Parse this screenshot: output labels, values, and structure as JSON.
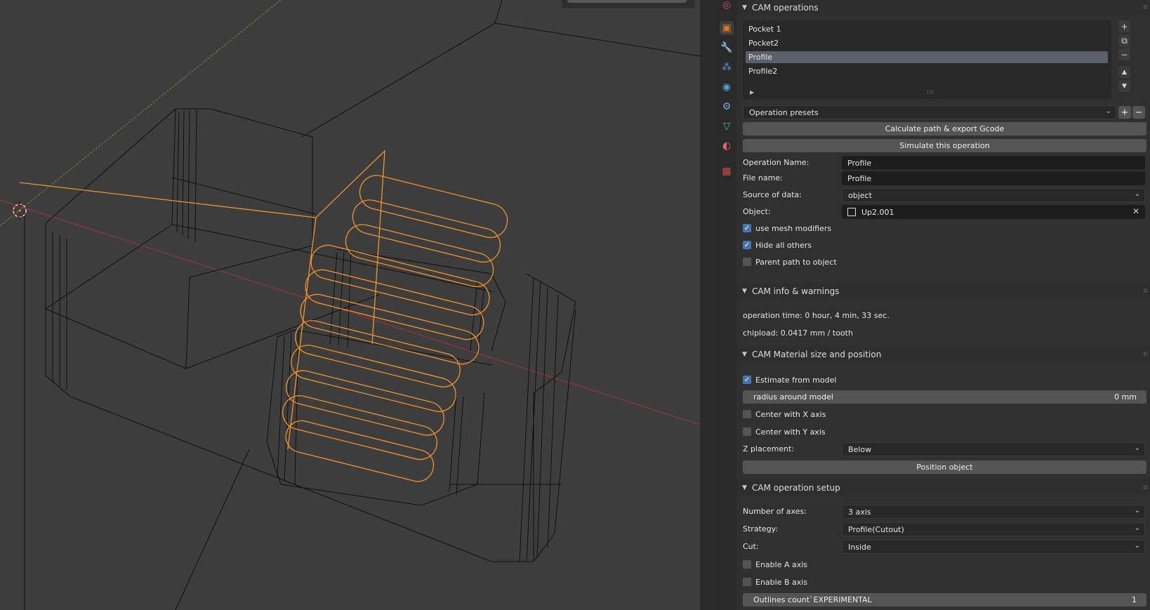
{
  "viewport": {
    "orange": "#f3942a",
    "wire": "#0a0a0a",
    "bg": "#3d3d3d"
  },
  "tabs": [
    {
      "icon": "world-icon",
      "glyph": "◎",
      "color": "#c0507a"
    },
    {
      "icon": "object-icon",
      "glyph": "▣",
      "color": "#e07a2a"
    },
    {
      "icon": "wrench-icon",
      "glyph": "🔧",
      "color": "#5a8cc8"
    },
    {
      "icon": "particles-icon",
      "glyph": "⁂",
      "color": "#5a9cd8"
    },
    {
      "icon": "physics-icon",
      "glyph": "◉",
      "color": "#5a9cd8"
    },
    {
      "icon": "constraints-icon",
      "glyph": "⚙",
      "color": "#7aa8d8"
    },
    {
      "icon": "data-icon",
      "glyph": "▽",
      "color": "#3cc07a"
    },
    {
      "icon": "material-icon",
      "glyph": "◐",
      "color": "#e06070"
    },
    {
      "icon": "texture-icon",
      "glyph": "▦",
      "color": "#d04848"
    }
  ],
  "cam_operations": {
    "title": "CAM operations",
    "items": [
      "Pocket 1",
      "Pocket2",
      "Profile",
      "Profile2"
    ],
    "selected": "Profile",
    "presets_label": "Operation presets",
    "calc_button": "Calculate path & export Gcode",
    "simulate_button": "Simulate this operation",
    "operation_name_label": "Operation Name:",
    "operation_name": "Profile",
    "file_name_label": "File name:",
    "file_name": "Profile",
    "source_label": "Source of data:",
    "source_value": "object",
    "object_label": "Object:",
    "object_value": "Up2.001",
    "use_mesh_modifiers": "use mesh modifiers",
    "hide_all_others": "Hide all others",
    "parent_path": "Parent path to object"
  },
  "cam_info": {
    "title": "CAM info & warnings",
    "operation_time": "operation time: 0 hour, 4 min, 33 sec.",
    "chipload": "chipload: 0.0417 mm  / tooth"
  },
  "cam_material": {
    "title": "CAM Material size and position",
    "estimate": "Estimate from model",
    "radius_label": "radius around model",
    "radius_value": "0 mm",
    "center_x": "Center with X axis",
    "center_y": "Center with Y axis",
    "z_label": "Z placement:",
    "z_value": "Below",
    "position_button": "Position object"
  },
  "cam_setup": {
    "title": "CAM operation setup",
    "axes_label": "Number of axes:",
    "axes_value": "3 axis",
    "strategy_label": "Strategy:",
    "strategy_value": "Profile(Cutout)",
    "cut_label": "Cut:",
    "cut_value": "Inside",
    "enable_a": "Enable A axis",
    "enable_b": "Enable B axis",
    "outlines_label": "Outlines count`EXPERIMENTAL",
    "outlines_value": "1"
  }
}
